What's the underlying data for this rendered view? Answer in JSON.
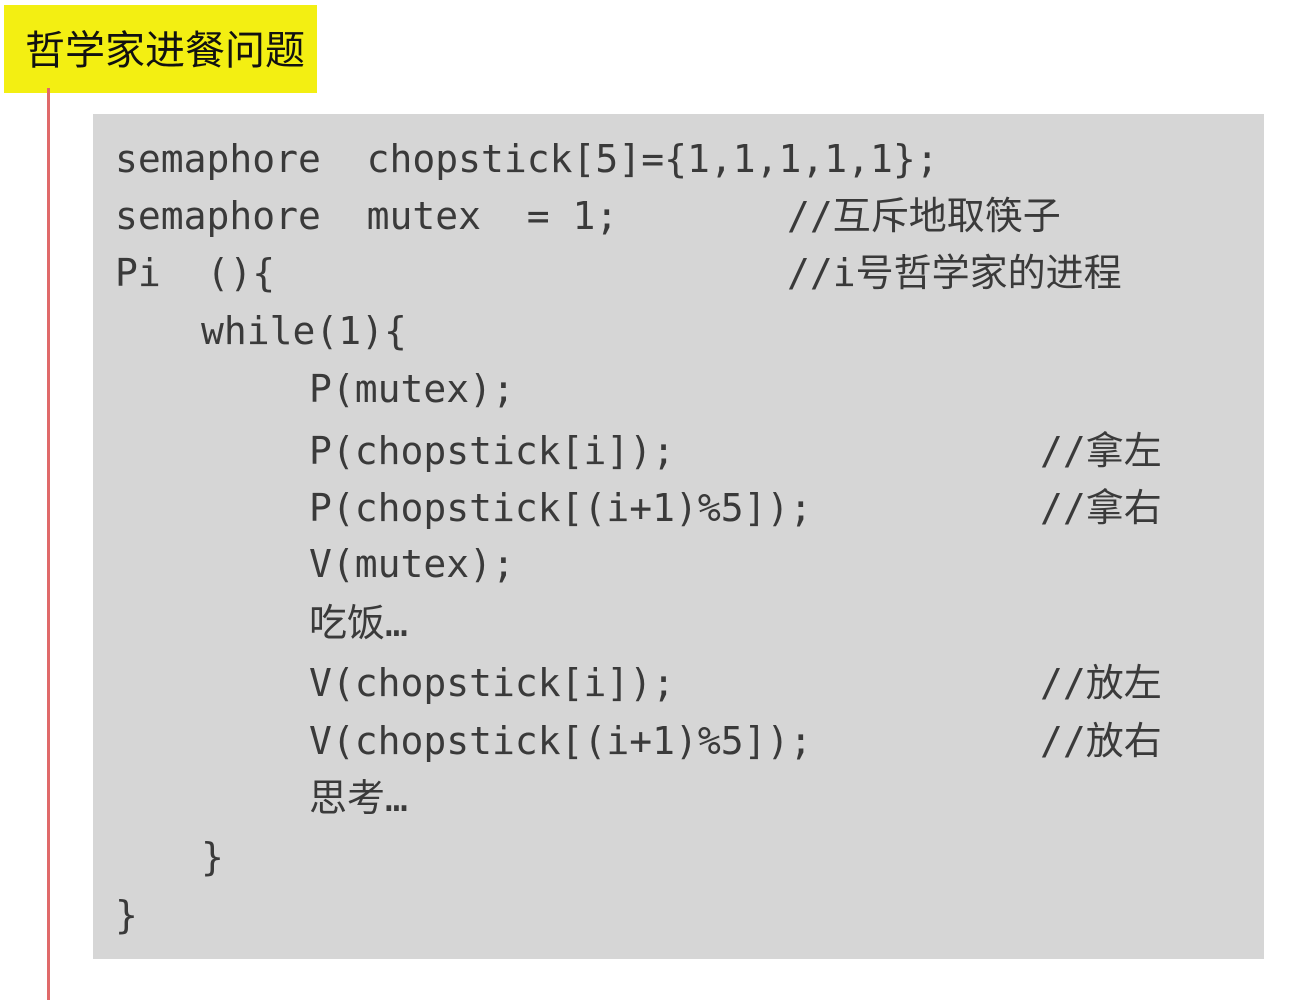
{
  "title": "哲学家进餐问题",
  "code": {
    "lines": [
      {
        "code": "semaphore  chopstick[5]={1,1,1,1,1};",
        "comment": ""
      },
      {
        "code": "semaphore  mutex  = 1;",
        "comment": "//互斥地取筷子"
      },
      {
        "code": "Pi  (){",
        "comment": "//i号哲学家的进程"
      },
      {
        "code": "while(1){",
        "comment": ""
      },
      {
        "code": "P(mutex);",
        "comment": ""
      },
      {
        "code": "P(chopstick[i]);",
        "comment": "//拿左"
      },
      {
        "code": "P(chopstick[(i+1)%5]);",
        "comment": "//拿右"
      },
      {
        "code": "V(mutex);",
        "comment": ""
      },
      {
        "code": "吃饭…",
        "comment": ""
      },
      {
        "code": "V(chopstick[i]);",
        "comment": "//放左"
      },
      {
        "code": "V(chopstick[(i+1)%5]);",
        "comment": "//放右"
      },
      {
        "code": "思考…",
        "comment": ""
      },
      {
        "code": "}",
        "comment": ""
      },
      {
        "code": "}",
        "comment": ""
      }
    ]
  }
}
